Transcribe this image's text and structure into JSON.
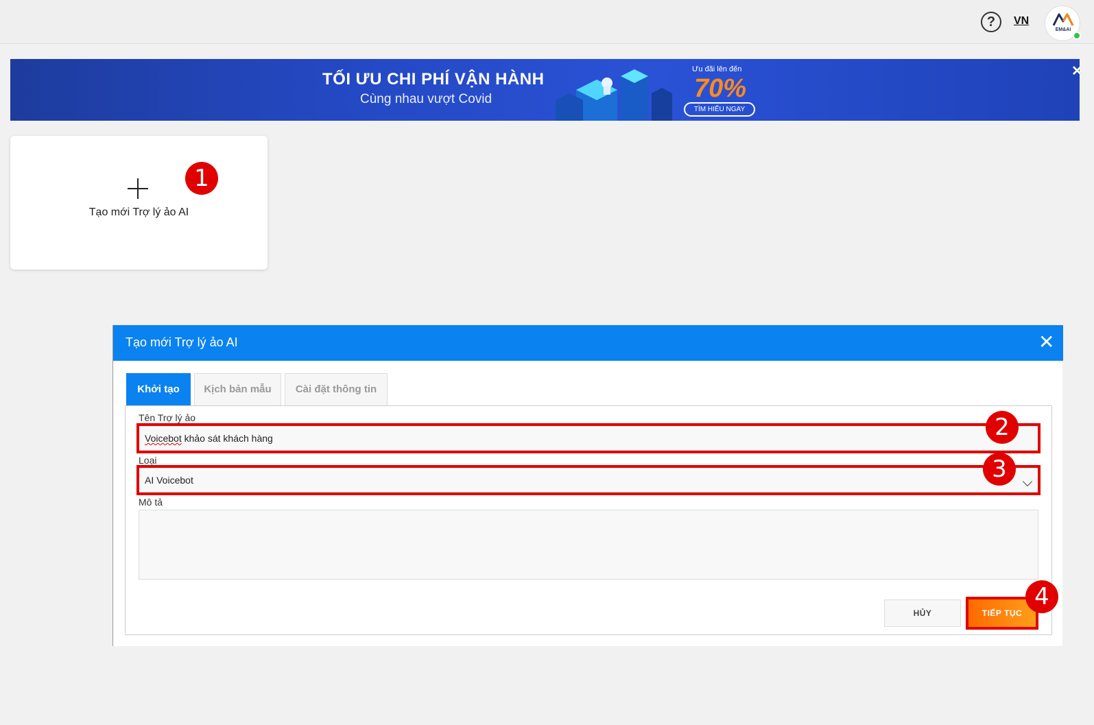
{
  "topbar": {
    "help_icon": "help-circle-icon",
    "help_glyph": "?",
    "language": "VN",
    "avatar_label": "EM&AI"
  },
  "banner": {
    "title": "TỐI ƯU CHI PHÍ VẬN HÀNH",
    "subtitle": "Cùng nhau vượt Covid",
    "promo_label": "Ưu đãi lên đến",
    "promo_value": "70%",
    "cta": "TÌM HIỂU NGAY",
    "close_glyph": "✕"
  },
  "new_card": {
    "label": "Tạo mới Trợ lý ảo AI"
  },
  "markers": [
    "1",
    "2",
    "3",
    "4"
  ],
  "modal": {
    "title": "Tạo mới Trợ lý ảo AI",
    "close_glyph": "✕",
    "tabs": [
      {
        "label": "Khởi tạo",
        "active": true
      },
      {
        "label": "Kịch bản mẫu",
        "active": false
      },
      {
        "label": "Cài đặt thông tin",
        "active": false
      }
    ],
    "fields": {
      "name_label": "Tên Trợ lý ảo",
      "name_value_underlined": "Voicebot",
      "name_value_rest": " khảo sát khách hàng",
      "type_label": "Loại",
      "type_value": "AI Voicebot",
      "description_label": "Mô tả",
      "description_value": ""
    },
    "buttons": {
      "cancel": "HỦY",
      "continue": "TIẾP TỤC"
    }
  },
  "colors": {
    "header_blue": "#0a82f0",
    "marker_red": "#e00000",
    "continue_orange": "#ff7a00"
  }
}
